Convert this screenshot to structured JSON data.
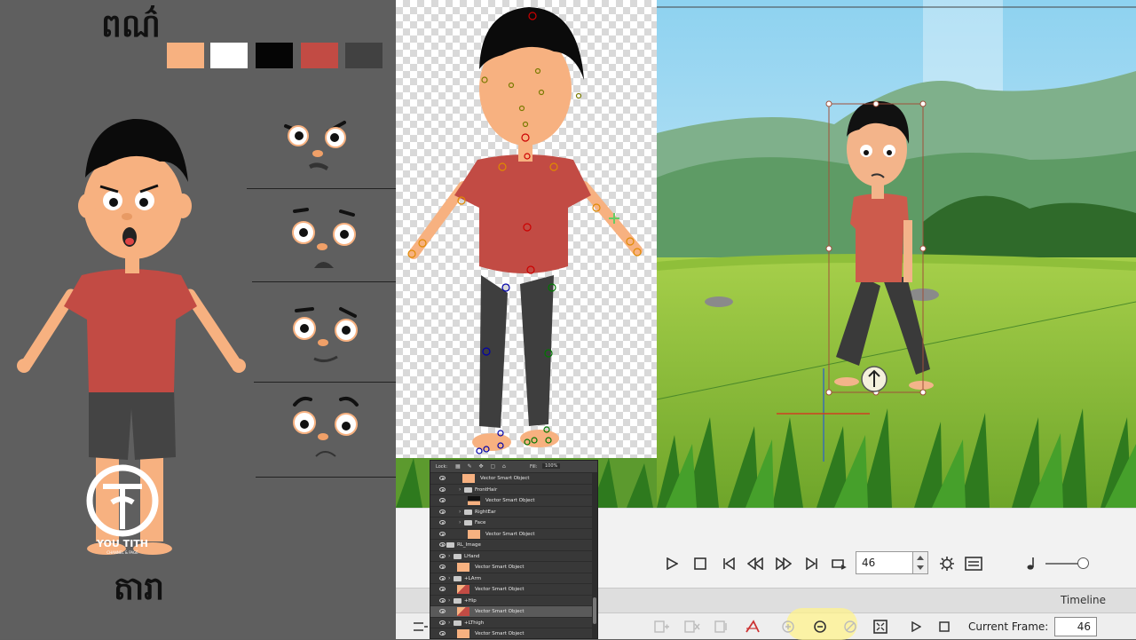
{
  "left_panel": {
    "colors_title": "ពណ៌",
    "skin_title": "តារា",
    "swatch_colors": [
      "#f7b180",
      "#ffffff",
      "#050505",
      "#c24b44",
      "#414141"
    ],
    "logo": {
      "name": "YOU TITH",
      "subtitle": "CHANNEL & PAGE"
    }
  },
  "layers_panel": {
    "lock_label": "Lock:",
    "fill_label": "Fill:",
    "fill_value": "100%",
    "rows": [
      {
        "label": "Vector Smart Object",
        "type": "smart",
        "indent": 52,
        "selected": false
      },
      {
        "label": "FrontHair",
        "type": "folder",
        "indent": 48,
        "selected": false
      },
      {
        "label": "Vector Smart Object",
        "type": "smart",
        "indent": 58,
        "selected": false
      },
      {
        "label": "RightEar",
        "type": "folder",
        "indent": 48,
        "selected": false
      },
      {
        "label": "Face",
        "type": "folder",
        "indent": 48,
        "selected": false
      },
      {
        "label": "Vector Smart Object",
        "type": "smart",
        "indent": 58,
        "selected": false
      },
      {
        "label": "RL_Image",
        "type": "folder",
        "indent": 28,
        "selected": false
      },
      {
        "label": "LHand",
        "type": "folder",
        "indent": 36,
        "selected": false
      },
      {
        "label": "Vector Smart Object",
        "type": "smart",
        "indent": 46,
        "selected": false
      },
      {
        "label": "+LArm",
        "type": "folder",
        "indent": 36,
        "selected": false
      },
      {
        "label": "Vector Smart Object",
        "type": "smart",
        "indent": 46,
        "selected": false
      },
      {
        "label": "+Hip",
        "type": "folder",
        "indent": 36,
        "selected": false
      },
      {
        "label": "Vector Smart Object",
        "type": "smart",
        "indent": 46,
        "selected": true
      },
      {
        "label": "+LThigh",
        "type": "folder",
        "indent": 36,
        "selected": false
      },
      {
        "label": "Vector Smart Object",
        "type": "smart",
        "indent": 46,
        "selected": false
      }
    ]
  },
  "playback": {
    "frame_value": "46",
    "icons": [
      "play-icon",
      "stop-icon",
      "first-frame-icon",
      "previous-key-icon",
      "next-key-icon",
      "last-frame-icon",
      "loop-icon",
      "settings-icon",
      "subtitle-icon",
      "music-note-icon"
    ]
  },
  "timeline": {
    "title": "Timeline",
    "current_frame_label": "Current Frame:",
    "current_frame_value": "46"
  }
}
